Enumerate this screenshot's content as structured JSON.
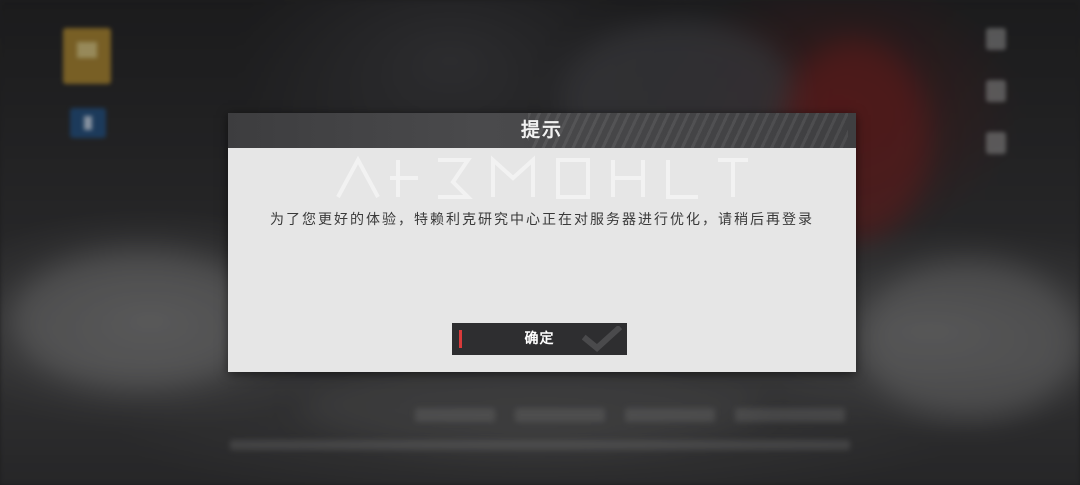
{
  "dialog": {
    "title": "提示",
    "message": "为了您更好的体验，特赖利克研究中心正在对服务器进行优化，请稍后再登录",
    "confirm_label": "确定",
    "accent_color": "#d93a3a"
  },
  "icons": {
    "confirm_decoration": "check-icon",
    "hud_left": [
      "menu-icon",
      "info-icon"
    ],
    "hud_right": [
      "settings-icon",
      "notice-icon",
      "mail-icon"
    ]
  }
}
